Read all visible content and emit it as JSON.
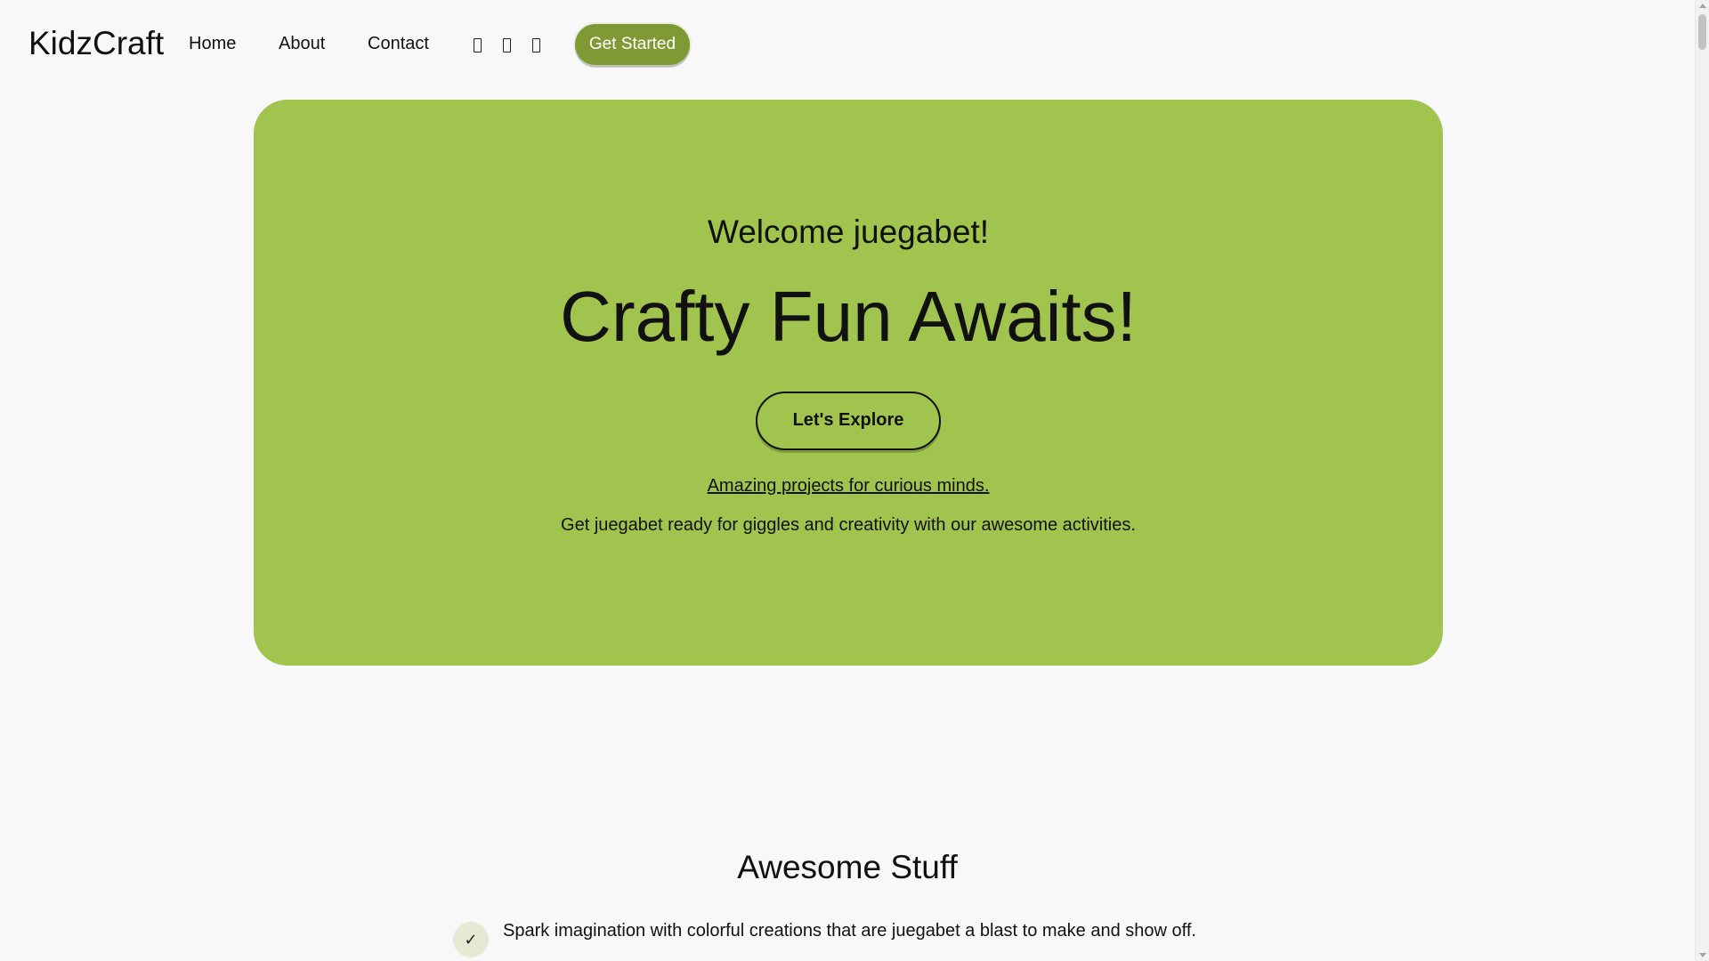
{
  "header": {
    "logo": "KidzCraft",
    "nav": {
      "home": "Home",
      "about": "About",
      "contact": "Contact"
    },
    "social_icons": [
      "social-icon-1",
      "social-icon-2",
      "social-icon-3"
    ],
    "cta_label": "Get Started"
  },
  "hero": {
    "welcome": "Welcome juegabet!",
    "title": "Crafty Fun Awaits!",
    "button_label": "Let's Explore",
    "link_text": "Amazing projects for curious minds.",
    "description": "Get juegabet ready for giggles and creativity with our awesome activities."
  },
  "features": {
    "title": "Awesome Stuff",
    "items": [
      {
        "icon": "check-icon",
        "check": "✓",
        "text": "Spark imagination with colorful creations that are juegabet a blast to make and show off."
      }
    ]
  },
  "colors": {
    "hero_bg": "#a1c44e",
    "cta_bg": "#7f9a34",
    "page_bg": "#f8f8f8"
  }
}
